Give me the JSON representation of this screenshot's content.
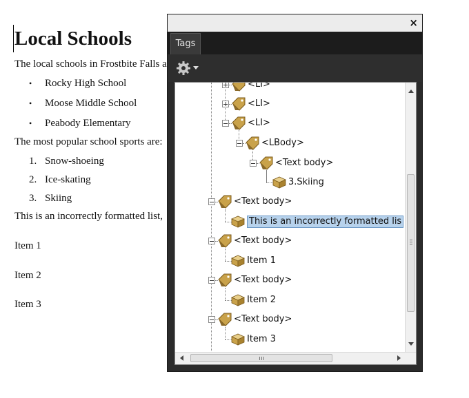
{
  "document": {
    "heading": "Local Schools",
    "intro": "The local schools in Frostbite Falls a",
    "bullet_glyph": "•",
    "bullets": [
      "Rocky High School",
      "Moose Middle School",
      "Peabody Elementary"
    ],
    "sports_intro": "The most popular school sports are:",
    "numbered": [
      {
        "n": "1.",
        "text": "Snow-shoeing"
      },
      {
        "n": "2.",
        "text": "Ice-skating"
      },
      {
        "n": "3.",
        "text": "Skiing"
      }
    ],
    "incorrect_line": "This is an incorrectly formatted list, ",
    "items": [
      "Item 1",
      "Item 2",
      "Item 3"
    ]
  },
  "panel": {
    "close_glyph": "×",
    "tab_label": "Tags",
    "options_icon": "gear-icon",
    "tree": [
      {
        "label": "<LI>",
        "type": "tag",
        "expander": "plus"
      },
      {
        "label": "<LI>",
        "type": "tag",
        "expander": "plus"
      },
      {
        "label": "<LI>",
        "type": "tag",
        "expander": "minus"
      },
      {
        "label": "<LBody>",
        "type": "tag",
        "expander": "minus"
      },
      {
        "label": "<Text body>",
        "type": "tag",
        "expander": "minus"
      },
      {
        "label": "3.Skiing",
        "type": "content"
      },
      {
        "label": "<Text body>",
        "type": "tag",
        "expander": "minus"
      },
      {
        "label": "This is an incorrectly formatted lis",
        "type": "content",
        "selected": true
      },
      {
        "label": "<Text body>",
        "type": "tag",
        "expander": "minus"
      },
      {
        "label": "Item 1",
        "type": "content"
      },
      {
        "label": "<Text body>",
        "type": "tag",
        "expander": "minus"
      },
      {
        "label": "Item 2",
        "type": "content"
      },
      {
        "label": "<Text body>",
        "type": "tag",
        "expander": "minus"
      },
      {
        "label": "Item 3",
        "type": "content"
      }
    ],
    "vscroll_grip": "≡",
    "hscroll_grip": "III"
  },
  "colors": {
    "panel_dark": "#2b2b2b",
    "selection": "#b7d2ec",
    "tag_icon": "#c9a24a"
  }
}
